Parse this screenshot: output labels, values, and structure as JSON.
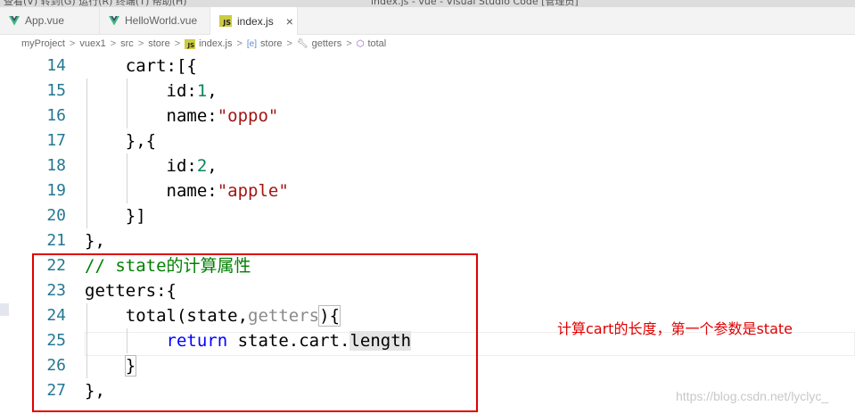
{
  "title_strip": {
    "left": "查看(V)  转到(G)  运行(R)  终端(T)  帮助(H)",
    "center": "index.js - vue - Visual Studio Code [管理员]"
  },
  "tabs": [
    {
      "label": "App.vue",
      "icon": "vue-icon",
      "active": false
    },
    {
      "label": "HelloWorld.vue",
      "icon": "vue-icon",
      "active": false
    },
    {
      "label": "index.js",
      "icon": "js-icon",
      "active": true,
      "close": "×"
    }
  ],
  "breadcrumb": {
    "items": [
      "myProject",
      "vuex1",
      "src",
      "store",
      "index.js",
      "store",
      "getters",
      "total"
    ],
    "separator": ">"
  },
  "editor": {
    "lines": [
      {
        "num": "14",
        "indent": "    ",
        "tokens": [
          {
            "t": "cart:[{"
          }
        ]
      },
      {
        "num": "15",
        "indent": "        ",
        "tokens": [
          {
            "t": "id:"
          },
          {
            "t": "1",
            "c": "num"
          },
          {
            "t": ","
          }
        ]
      },
      {
        "num": "16",
        "indent": "        ",
        "tokens": [
          {
            "t": "name:"
          },
          {
            "t": "\"oppo\"",
            "c": "str"
          }
        ]
      },
      {
        "num": "17",
        "indent": "    ",
        "tokens": [
          {
            "t": "},{"
          }
        ]
      },
      {
        "num": "18",
        "indent": "        ",
        "tokens": [
          {
            "t": "id:"
          },
          {
            "t": "2",
            "c": "num"
          },
          {
            "t": ","
          }
        ]
      },
      {
        "num": "19",
        "indent": "        ",
        "tokens": [
          {
            "t": "name:"
          },
          {
            "t": "\"apple\"",
            "c": "str"
          }
        ]
      },
      {
        "num": "20",
        "indent": "    ",
        "tokens": [
          {
            "t": "}]"
          }
        ]
      },
      {
        "num": "21",
        "indent": "",
        "tokens": [
          {
            "t": "},"
          }
        ]
      },
      {
        "num": "22",
        "indent": "",
        "tokens": [
          {
            "t": "// state的计算属性",
            "c": "cmt"
          }
        ]
      },
      {
        "num": "23",
        "indent": "",
        "tokens": [
          {
            "t": "getters:{"
          }
        ]
      },
      {
        "num": "24",
        "indent": "    ",
        "tokens": [
          {
            "t": "total(state,"
          },
          {
            "t": "getters",
            "c": "dim"
          },
          {
            "t": "){",
            "c": "brk"
          }
        ]
      },
      {
        "num": "25",
        "indent": "        ",
        "tokens": [
          {
            "t": "return",
            "c": "kw"
          },
          {
            "t": " state.cart."
          },
          {
            "t": "length",
            "c": "hl"
          }
        ]
      },
      {
        "num": "26",
        "indent": "    ",
        "tokens": [
          {
            "t": "}",
            "c": "brk"
          }
        ]
      },
      {
        "num": "27",
        "indent": "",
        "tokens": [
          {
            "t": "},"
          }
        ]
      }
    ]
  },
  "annotation": "计算cart的长度，第一个参数是state",
  "watermark": "https://blog.csdn.net/lyclyc_",
  "colors": {
    "highlight_box": "#e00000",
    "keyword": "#0000ff",
    "string": "#a31515",
    "number": "#098658",
    "comment": "#008000",
    "line_number": "#237893"
  }
}
